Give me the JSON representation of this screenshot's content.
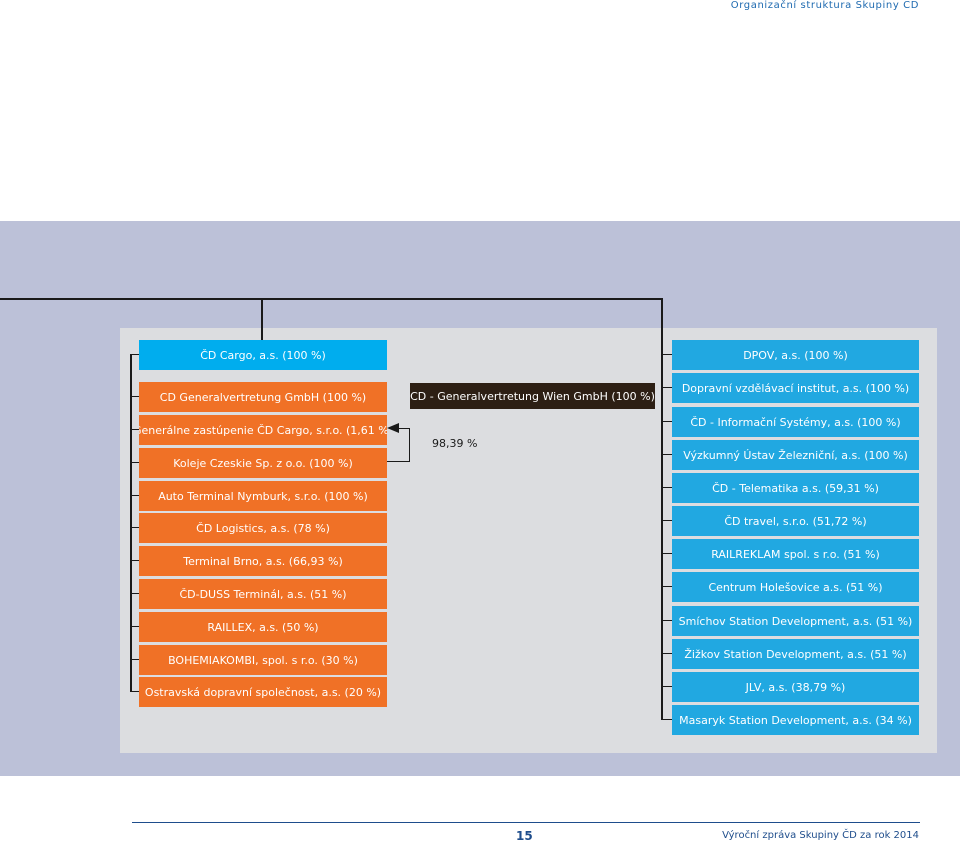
{
  "header": {
    "title": "Organizační struktura Skupiny ČD"
  },
  "cargo": {
    "head": "ČD Cargo, a.s. (100 %)",
    "subsidiaries": [
      "CD Generalvertretung GmbH (100 %)",
      "Generálne zastúpenie ČD Cargo, s.r.o. (1,61 %)",
      "Koleje Czeskie Sp. z o.o. (100 %)",
      "Auto Terminal Nymburk, s.r.o. (100 %)",
      "ČD Logistics, a.s. (78 %)",
      "Terminal Brno, a.s. (66,93 %)",
      "ČD-DUSS Terminál, a.s. (51 %)",
      "RAILLEX, a.s. (50 %)",
      "BOHEMIAKOMBI, spol. s r.o. (30 %)",
      "Ostravská dopravní společnost, a.s. (20 %)"
    ]
  },
  "wien": {
    "label": "CD - Generalvertretung Wien GmbH (100 %)",
    "share": "98,39 %"
  },
  "parent_direct": {
    "head": "DPOV, a.s. (100 %)",
    "subsidiaries": [
      "Dopravní vzdělávací institut, a.s. (100 %)",
      "ČD - Informační Systémy, a.s. (100 %)",
      "Výzkumný Ústav Železniční, a.s. (100 %)",
      "ČD - Telematika a.s. (59,31 %)",
      "ČD travel, s.r.o. (51,72 %)",
      "RAILREKLAM spol. s r.o. (51 %)",
      "Centrum Holešovice a.s. (51 %)",
      "Smíchov Station Development, a.s. (51 %)",
      "Žižkov Station Development, a.s. (51 %)",
      "JLV, a.s. (38,79 %)",
      "Masaryk Station Development, a.s. (34 %)"
    ]
  },
  "footer": {
    "page": "15",
    "report": "Výroční zpráva Skupiny ČD za rok 2014"
  },
  "colors": {
    "orange": "#f07126",
    "blue": "#21a8e1",
    "cyan": "#00adee",
    "dark": "#2d1f14",
    "outer_bg": "#bcc1d8",
    "inner_bg": "#dcdde0",
    "accent": "#1e4d8c"
  }
}
